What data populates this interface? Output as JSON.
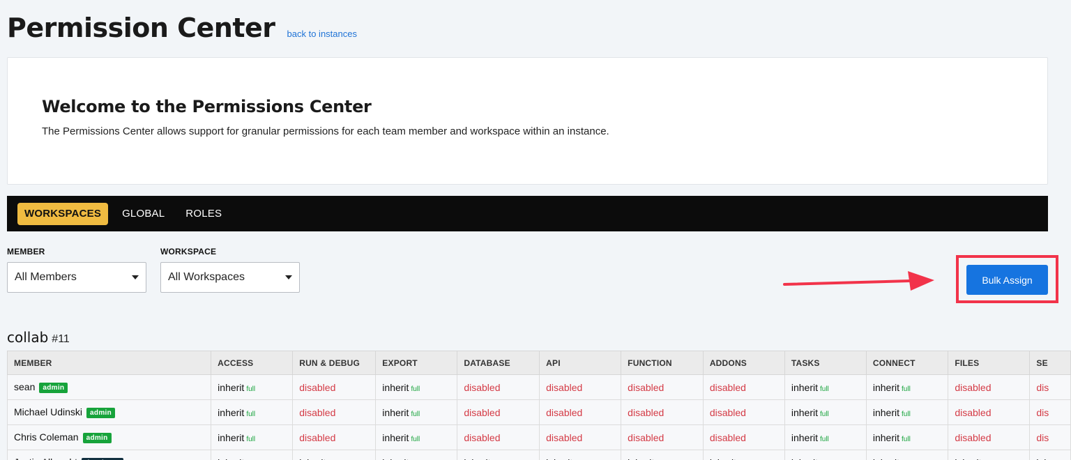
{
  "header": {
    "title": "Permission Center",
    "back_link": "back to instances"
  },
  "welcome": {
    "title": "Welcome to the Permissions Center",
    "text": "The Permissions Center allows support for granular permissions for each team member and workspace within an instance."
  },
  "tabs": [
    {
      "label": "WORKSPACES",
      "active": true
    },
    {
      "label": "GLOBAL",
      "active": false
    },
    {
      "label": "ROLES",
      "active": false
    }
  ],
  "filters": {
    "member": {
      "label": "MEMBER",
      "value": "All Members"
    },
    "workspace": {
      "label": "WORKSPACE",
      "value": "All Workspaces"
    }
  },
  "bulk_assign": {
    "label": "Bulk Assign"
  },
  "workspace": {
    "name": "collab",
    "id": "#11"
  },
  "table": {
    "columns": [
      "MEMBER",
      "ACCESS",
      "RUN & DEBUG",
      "EXPORT",
      "DATABASE",
      "API",
      "FUNCTION",
      "ADDONS",
      "TASKS",
      "CONNECT",
      "FILES",
      "SE"
    ],
    "rows": [
      {
        "member": "sean",
        "badge": "admin",
        "badge_style": "green",
        "cells": [
          {
            "value": "inherit",
            "suffix": "full"
          },
          {
            "value": "disabled"
          },
          {
            "value": "inherit",
            "suffix": "full"
          },
          {
            "value": "disabled"
          },
          {
            "value": "disabled"
          },
          {
            "value": "disabled"
          },
          {
            "value": "disabled"
          },
          {
            "value": "inherit",
            "suffix": "full"
          },
          {
            "value": "inherit",
            "suffix": "full"
          },
          {
            "value": "disabled"
          },
          {
            "value": "dis"
          }
        ]
      },
      {
        "member": "Michael Udinski",
        "badge": "admin",
        "badge_style": "green",
        "cells": [
          {
            "value": "inherit",
            "suffix": "full"
          },
          {
            "value": "disabled"
          },
          {
            "value": "inherit",
            "suffix": "full"
          },
          {
            "value": "disabled"
          },
          {
            "value": "disabled"
          },
          {
            "value": "disabled"
          },
          {
            "value": "disabled"
          },
          {
            "value": "inherit",
            "suffix": "full"
          },
          {
            "value": "inherit",
            "suffix": "full"
          },
          {
            "value": "disabled"
          },
          {
            "value": "dis"
          }
        ]
      },
      {
        "member": "Chris Coleman",
        "badge": "admin",
        "badge_style": "green",
        "cells": [
          {
            "value": "inherit",
            "suffix": "full"
          },
          {
            "value": "disabled"
          },
          {
            "value": "inherit",
            "suffix": "full"
          },
          {
            "value": "disabled"
          },
          {
            "value": "disabled"
          },
          {
            "value": "disabled"
          },
          {
            "value": "disabled"
          },
          {
            "value": "inherit",
            "suffix": "full"
          },
          {
            "value": "inherit",
            "suffix": "full"
          },
          {
            "value": "disabled"
          },
          {
            "value": "dis"
          }
        ]
      },
      {
        "member": "Justin Albrecht",
        "badge": "developer",
        "badge_style": "dark",
        "cells": [
          {
            "value": "inherit",
            "suffix": "full"
          },
          {
            "value": "inherit",
            "suffix": "full"
          },
          {
            "value": "inherit",
            "suffix": "full"
          },
          {
            "value": "inherit",
            "suffix": "full"
          },
          {
            "value": "inherit",
            "suffix": "full"
          },
          {
            "value": "inherit",
            "suffix": "full"
          },
          {
            "value": "inherit",
            "suffix": "full"
          },
          {
            "value": "inherit",
            "suffix": "full"
          },
          {
            "value": "inherit",
            "suffix": "full"
          },
          {
            "value": "inherit",
            "suffix": "full"
          },
          {
            "value": "inh"
          }
        ]
      }
    ]
  },
  "colors": {
    "accent": "#f0bb41",
    "primary": "#1674e0",
    "annotation": "#f2334a",
    "full": "#17a33b",
    "disabled": "#d43a45"
  }
}
